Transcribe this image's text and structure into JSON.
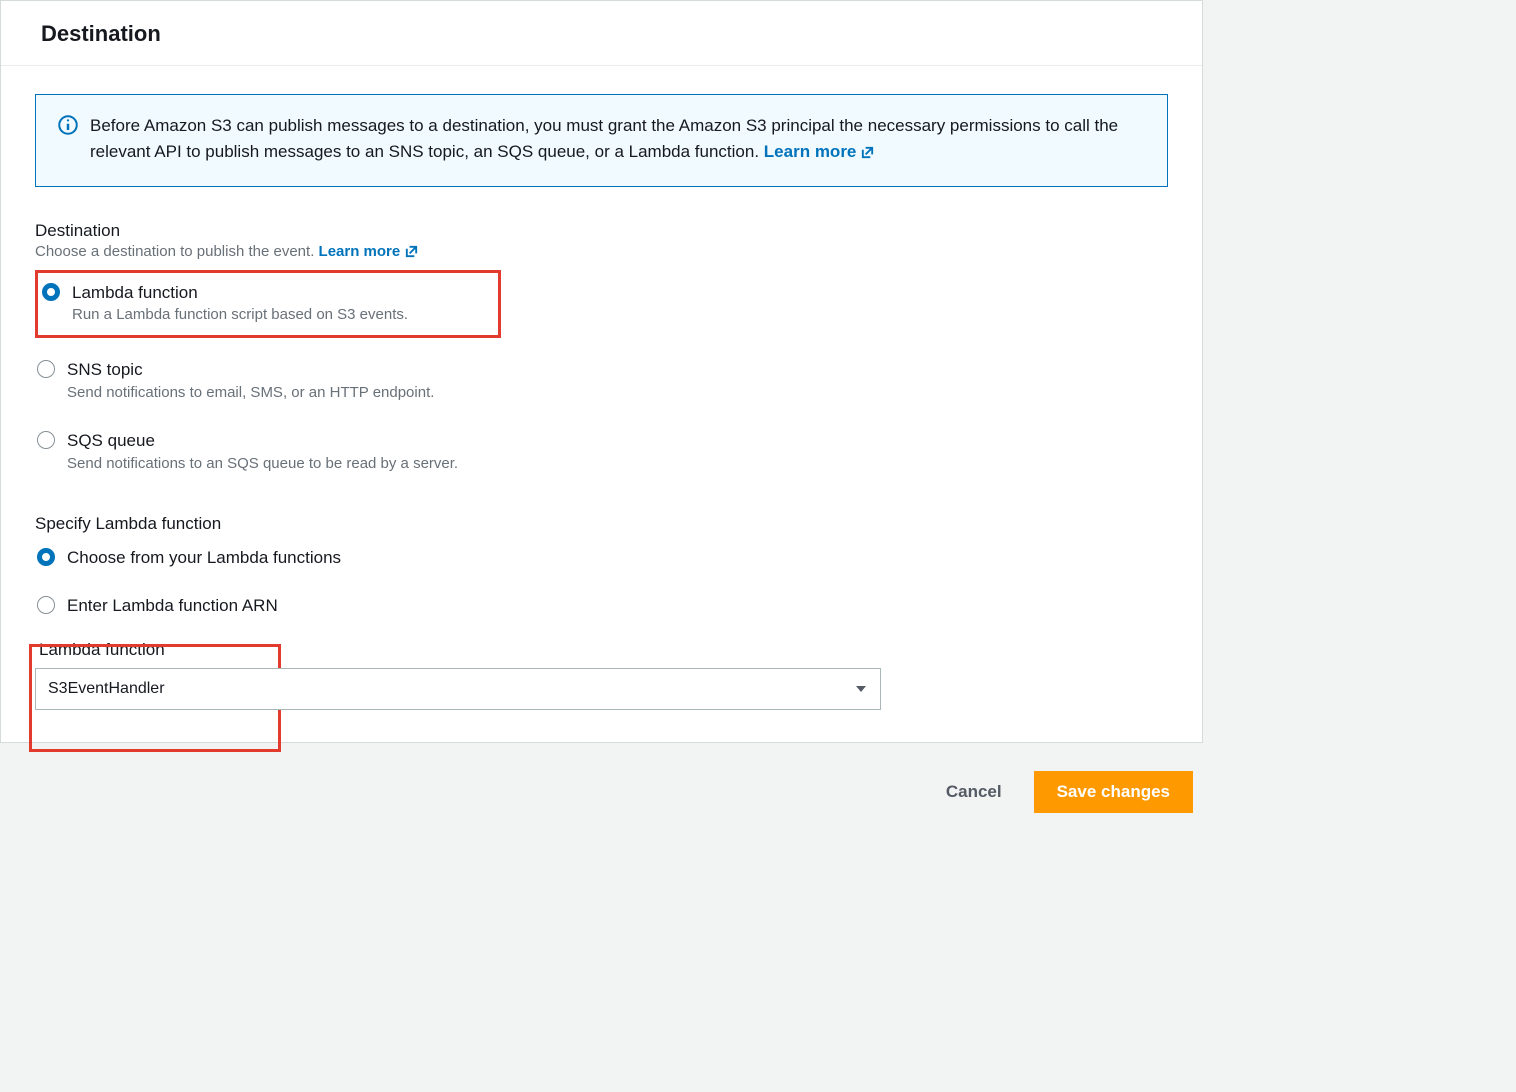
{
  "header": {
    "title": "Destination"
  },
  "info": {
    "text": "Before Amazon S3 can publish messages to a destination, you must grant the Amazon S3 principal the necessary permissions to call the relevant API to publish messages to an SNS topic, an SQS queue, or a Lambda function. ",
    "learn_more": "Learn more"
  },
  "destination": {
    "label": "Destination",
    "desc": "Choose a destination to publish the event. ",
    "learn_more": "Learn more",
    "options": [
      {
        "title": "Lambda function",
        "desc": "Run a Lambda function script based on S3 events.",
        "checked": true
      },
      {
        "title": "SNS topic",
        "desc": "Send notifications to email, SMS, or an HTTP endpoint.",
        "checked": false
      },
      {
        "title": "SQS queue",
        "desc": "Send notifications to an SQS queue to be read by a server.",
        "checked": false
      }
    ]
  },
  "specify": {
    "label": "Specify Lambda function",
    "options": [
      {
        "title": "Choose from your Lambda functions",
        "checked": true
      },
      {
        "title": "Enter Lambda function ARN",
        "checked": false
      }
    ]
  },
  "lambda_select": {
    "label": "Lambda function",
    "value": "S3EventHandler"
  },
  "footer": {
    "cancel": "Cancel",
    "save": "Save changes"
  }
}
